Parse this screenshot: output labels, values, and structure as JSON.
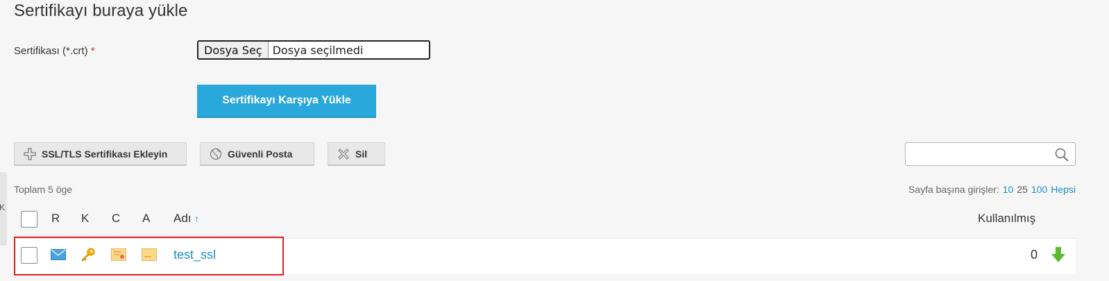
{
  "page": {
    "title": "Sertifikayı buraya yükle"
  },
  "upload_form": {
    "certificate_label": "Sertifikası (*.crt)",
    "required_mark": "*",
    "file_button_label": "Dosya Seç",
    "file_status": "Dosya seçilmedi",
    "submit_label": "Sertifikayı Karşıya Yükle"
  },
  "toolbar": {
    "add_label": "SSL/TLS Sertifikası Ekleyin",
    "add_icon": "plus-icon",
    "mail_label": "Güvenli Posta",
    "mail_icon": "globe-icon",
    "delete_label": "Sil",
    "delete_icon": "cross-icon",
    "search_value": "",
    "search_icon": "search-icon"
  },
  "list": {
    "total_text": "Toplam 5 öge",
    "per_page_label": "Sayfa başına girişler:",
    "per_page_options": [
      "10",
      "25",
      "100",
      "Hepsi"
    ],
    "columns": {
      "r": "R",
      "k": "K",
      "c": "C",
      "a": "A",
      "name": "Adı",
      "name_sort": "↑",
      "used": "Kullanılmış"
    },
    "rows": [
      {
        "name": "test_ssl",
        "used": "0",
        "icons": [
          "mail-icon",
          "key-icon",
          "certificate-icon",
          "ca-certificate-icon"
        ],
        "action_icon": "download-arrow-icon"
      }
    ]
  },
  "side_tab": {
    "glyph": "K"
  },
  "colors": {
    "accent": "#29a8dc",
    "link": "#1f8fbd",
    "highlight": "#e02020",
    "download": "#5cb82f"
  }
}
